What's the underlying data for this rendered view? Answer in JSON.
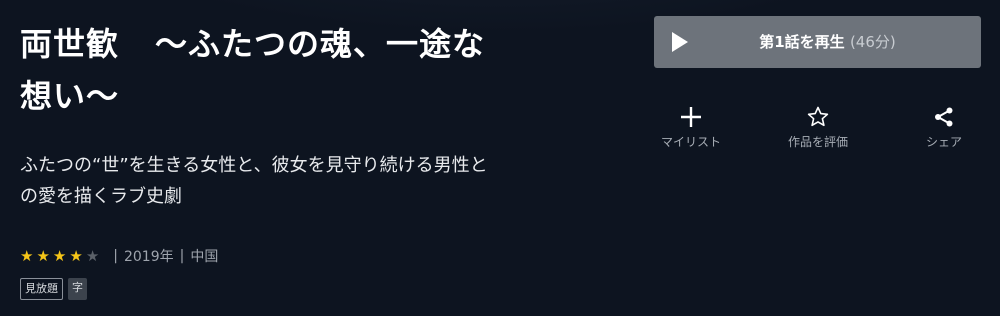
{
  "title": {
    "part1": "両世歓",
    "part2": "〜ふたつの魂、一途な",
    "line2": "想い〜"
  },
  "synopsis": {
    "line1": "ふたつの“世”を生きる女性と、彼女を見守り続ける男性と",
    "line2": "の愛を描くラブ史劇"
  },
  "rating": {
    "value": 4,
    "max": 5
  },
  "meta": {
    "year": "2019年",
    "country": "中国"
  },
  "badges": {
    "mihoudai": "見放題",
    "subtitle": "字"
  },
  "play": {
    "label": "第1話を再生",
    "duration": "(46分)"
  },
  "actions": {
    "mylist": "マイリスト",
    "rate": "作品を評価",
    "share": "シェア"
  },
  "colors": {
    "star_on": "#f5c518",
    "star_off": "#5b6169",
    "play_bg": "#6d737b"
  }
}
